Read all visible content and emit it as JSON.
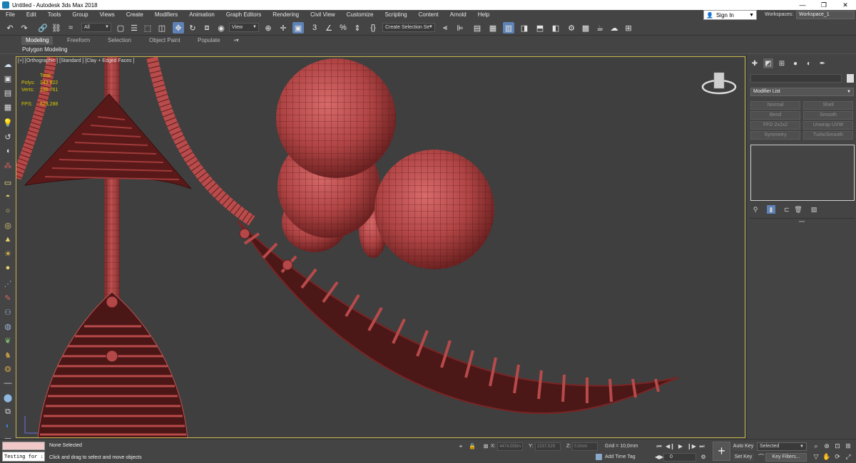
{
  "window": {
    "title": "Untitled - Autodesk 3ds Max 2018",
    "minimize": "—",
    "maximize": "❐",
    "close": "✕"
  },
  "menu": {
    "items": [
      "File",
      "Edit",
      "Tools",
      "Group",
      "Views",
      "Create",
      "Modifiers",
      "Animation",
      "Graph Editors",
      "Rendering",
      "Civil View",
      "Customize",
      "Scripting",
      "Content",
      "Arnold",
      "Help"
    ],
    "sign_in": "Sign In",
    "workspaces_label": "Workspaces:",
    "workspace_value": "Workspace_1"
  },
  "toolbar": {
    "selection_filter": "All",
    "ref_coord": "View",
    "selection_set": "Create Selection Se"
  },
  "ribbon": {
    "tabs": [
      "Modeling",
      "Freeform",
      "Selection",
      "Object Paint",
      "Populate"
    ],
    "active_tab": "Modeling",
    "subpanel": "Polygon Modeling"
  },
  "viewport": {
    "label": "[+] [Orthographic ] [Standard ] [Clay + Edged Faces ]",
    "stats": {
      "total_label": "Total",
      "polys_label": "Polys:",
      "polys_value": "243 822",
      "verts_label": "Verts:",
      "verts_value": "135 761",
      "fps_label": "FPS:",
      "fps_value": "623,288"
    },
    "colors": {
      "mesh": "#a83a3a",
      "background": "#3f3f3f",
      "frame": "#c8b64a"
    }
  },
  "command_panel": {
    "modifier_list": "Modifier List",
    "buttons": [
      "Normal",
      "Shell",
      "Bend",
      "Smooth",
      "FFD 2x2x2",
      "Unwrap UVW",
      "Symmetry",
      "TurboSmooth"
    ]
  },
  "status": {
    "maxscript_text": "Testing for :",
    "selection": "None Selected",
    "prompt": "Click and drag to select and move objects",
    "x_label": "X:",
    "x_value": "4474,055m",
    "y_label": "Y:",
    "y_value": "2237,529",
    "z_label": "Z:",
    "z_value": "0,0mm",
    "grid": "Grid = 10,0mm",
    "add_time_tag": "Add Time Tag",
    "frame": "0",
    "auto_key": "Auto Key",
    "set_key": "Set Key",
    "selected": "Selected",
    "key_filters": "Key Filters..."
  }
}
